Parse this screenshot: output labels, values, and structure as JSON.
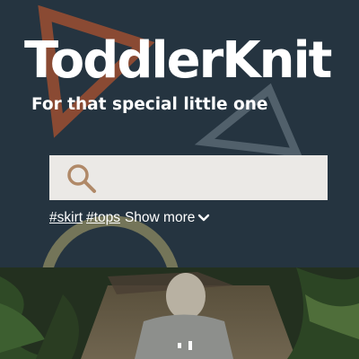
{
  "brand": {
    "title": "ToddlerKnit",
    "tagline": "For that special little one"
  },
  "search": {
    "placeholder": "",
    "value": ""
  },
  "tags": {
    "items": [
      "#skirt",
      "#tops"
    ],
    "show_more_label": "Show more"
  },
  "colors": {
    "background": "#253440",
    "accent_orange": "#8a4a33",
    "accent_slate": "#51606b",
    "accent_olive": "#747559",
    "search_bg": "#ebe9e6",
    "search_icon": "#b08968"
  }
}
